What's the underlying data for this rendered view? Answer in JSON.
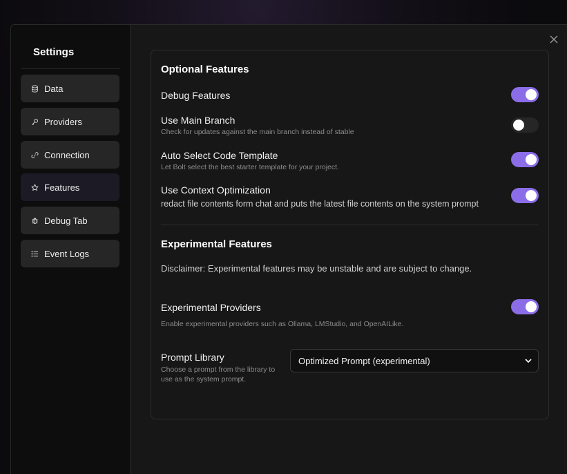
{
  "sidebar": {
    "title": "Settings",
    "items": [
      {
        "label": "Data",
        "icon": "database-icon"
      },
      {
        "label": "Providers",
        "icon": "key-icon"
      },
      {
        "label": "Connection",
        "icon": "link-icon"
      },
      {
        "label": "Features",
        "icon": "star-icon",
        "active": true
      },
      {
        "label": "Debug Tab",
        "icon": "bug-icon"
      },
      {
        "label": "Event Logs",
        "icon": "list-icon"
      }
    ]
  },
  "optional": {
    "title": "Optional Features",
    "debug": {
      "title": "Debug Features",
      "enabled": true
    },
    "main_branch": {
      "title": "Use Main Branch",
      "desc": "Check for updates against the main branch instead of stable",
      "enabled": false
    },
    "auto_template": {
      "title": "Auto Select Code Template",
      "desc": "Let Bolt select the best starter template for your project.",
      "enabled": true
    },
    "context_opt": {
      "title": "Use Context Optimization",
      "desc": "redact file contents form chat and puts the latest file contents on the system prompt",
      "enabled": true
    }
  },
  "experimental": {
    "title": "Experimental Features",
    "disclaimer": "Disclaimer: Experimental features may be unstable and are subject to change.",
    "providers": {
      "title": "Experimental Providers",
      "desc": "Enable experimental providers such as Ollama, LMStudio, and OpenAILike.",
      "enabled": true
    },
    "prompt_library": {
      "title": "Prompt Library",
      "desc": "Choose a prompt from the library to use as the system prompt.",
      "selected": "Optimized Prompt (experimental)"
    }
  },
  "colors": {
    "accent": "#8b6de8",
    "toggle_off": "#262626",
    "background": "#171717",
    "sidebar": "#0d0d0d"
  }
}
